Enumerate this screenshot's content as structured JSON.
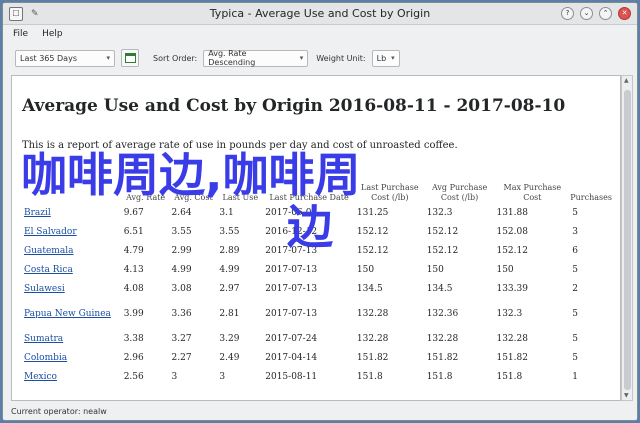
{
  "window": {
    "title": "Typica - Average Use and Cost by Origin"
  },
  "menu": {
    "file": "File",
    "help": "Help"
  },
  "toolbar": {
    "date_range": "Last 365 Days",
    "sort_label": "Sort Order:",
    "sort_value": "Avg. Rate Descending",
    "weight_label": "Weight Unit:",
    "weight_value": "Lb"
  },
  "report": {
    "title": "Average Use and Cost by Origin 2016-08-11 - 2017-08-10",
    "description": "This is a report of average rate of use in pounds per day and cost of unroasted coffee.",
    "headers": [
      "",
      "Avg. Rate",
      "Avg. Cost",
      "Last Use",
      "Last Purchase Date",
      "Last Purchase Cost (/lb)",
      "Avg Purchase Cost (/lb)",
      "Max Purchase Cost",
      "Purchases"
    ],
    "rows": [
      [
        "Brazil",
        "9.67",
        "2.64",
        "3.1",
        "2017-06-01",
        "131.25",
        "132.3",
        "131.88",
        "5"
      ],
      [
        "El Salvador",
        "6.51",
        "3.55",
        "3.55",
        "2016-12-12",
        "152.12",
        "152.12",
        "152.08",
        "3"
      ],
      [
        "Guatemala",
        "4.79",
        "2.99",
        "2.89",
        "2017-07-13",
        "152.12",
        "152.12",
        "152.12",
        "6"
      ],
      [
        "Costa Rica",
        "4.13",
        "4.99",
        "4.99",
        "2017-07-13",
        "150",
        "150",
        "150",
        "5"
      ],
      [
        "Sulawesi",
        "4.08",
        "3.08",
        "2.97",
        "2017-07-13",
        "134.5",
        "134.5",
        "133.39",
        "2"
      ],
      [
        "Papua New Guinea",
        "3.99",
        "3.36",
        "2.81",
        "2017-07-13",
        "132.28",
        "132.36",
        "132.3",
        "5"
      ],
      [
        "Sumatra",
        "3.38",
        "3.27",
        "3.29",
        "2017-07-24",
        "132.28",
        "132.28",
        "132.28",
        "5"
      ],
      [
        "Colombia",
        "2.96",
        "2.27",
        "2.49",
        "2017-04-14",
        "151.82",
        "151.82",
        "151.82",
        "5"
      ],
      [
        "Mexico",
        "2.56",
        "3",
        "3",
        "2015-08-11",
        "151.8",
        "151.8",
        "151.8",
        "1"
      ]
    ]
  },
  "overlay": {
    "line1": "咖啡周边,咖啡周",
    "line2": "边"
  },
  "status": {
    "text": "Current operator: nealw"
  },
  "colors": {
    "link": "#1a4fa3",
    "overlay": "#3a3ce8"
  }
}
